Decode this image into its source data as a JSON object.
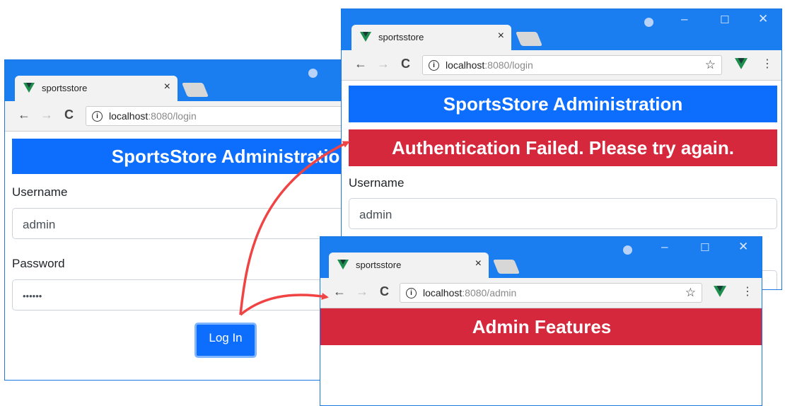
{
  "browser": {
    "tab_title": "sportsstore",
    "tab_close": "×",
    "nav_back": "←",
    "nav_forward": "→",
    "nav_reload": "C",
    "menu_glyph": "⋮",
    "bookmark_glyph": "☆",
    "window_minimize": "–",
    "window_maximize": "☐",
    "window_close": "✕"
  },
  "window_login": {
    "url_host": "localhost",
    "url_port_path": ":8080/login",
    "banner": "SportsStore Administration",
    "username_label": "Username",
    "username_value": "admin",
    "password_label": "Password",
    "password_value": "••••••",
    "login_button": "Log In"
  },
  "window_failed": {
    "url_host": "localhost",
    "url_port_path": ":8080/login",
    "banner": "SportsStore Administration",
    "error_banner": "Authentication Failed. Please try again.",
    "username_label": "Username",
    "username_value": "admin"
  },
  "window_admin": {
    "url_host": "localhost",
    "url_port_path": ":8080/admin",
    "banner": "Admin Features"
  },
  "colors": {
    "title_bar": "#1b7ef0",
    "primary": "#0d6efd",
    "danger": "#d6283d",
    "arrow": "#f04444",
    "vue_green": "#1e8e4e"
  }
}
